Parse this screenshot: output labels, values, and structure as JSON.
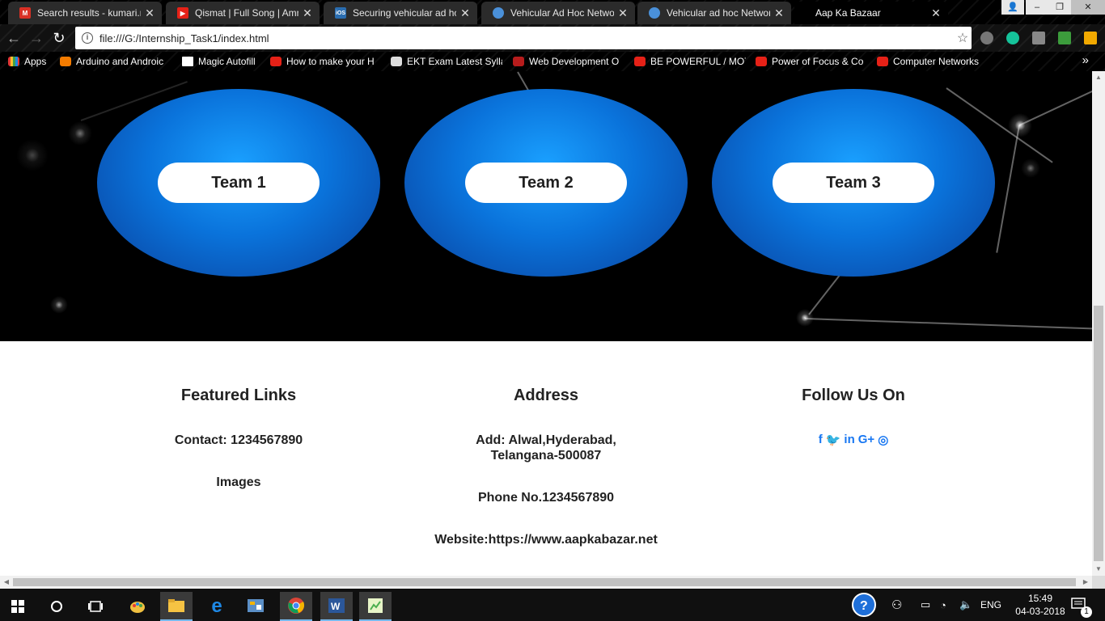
{
  "browser": {
    "tabs": [
      {
        "title": "Search results - kumari.re",
        "icon": "gmail-icon",
        "color": "#d93025"
      },
      {
        "title": "Qismat | Full Song | Amm",
        "icon": "youtube-icon",
        "color": "#e62117"
      },
      {
        "title": "Securing vehicular ad ho",
        "icon": "ios-icon",
        "color": "#2a6db0",
        "icon_text": "iOS"
      },
      {
        "title": "Vehicular Ad Hoc Networ",
        "icon": "document-icon",
        "color": "#4a90d9"
      },
      {
        "title": "Vehicular ad hoc Networ",
        "icon": "document-icon",
        "color": "#4a90d9"
      },
      {
        "title": "Aap Ka Bazaar",
        "icon": "",
        "color": "#000000"
      }
    ],
    "url": "file:///G:/Internship_Task1/index.html",
    "bookmarks": [
      {
        "label": "Apps",
        "icon": "apps-grid-icon"
      },
      {
        "label": "Arduino and Androic",
        "icon": "blogger-icon"
      },
      {
        "label": "Magic Autofill",
        "icon": "page-icon"
      },
      {
        "label": "How to make your H",
        "icon": "youtube-icon"
      },
      {
        "label": "EKT Exam Latest Sylla",
        "icon": "ekt-icon"
      },
      {
        "label": "Web Development O",
        "icon": "infinity-icon"
      },
      {
        "label": "BE POWERFUL / MOT",
        "icon": "youtube-icon"
      },
      {
        "label": "Power of Focus & Co",
        "icon": "youtube-icon"
      },
      {
        "label": "Computer Networks",
        "icon": "youtube-icon"
      }
    ],
    "bookmarks_more": "»"
  },
  "hero": {
    "teams": [
      {
        "label": "Team 1"
      },
      {
        "label": "Team 2"
      },
      {
        "label": "Team 3"
      }
    ]
  },
  "footer": {
    "featured": {
      "heading": "Featured Links",
      "contact": "Contact: 1234567890",
      "images": "Images"
    },
    "address": {
      "heading": "Address",
      "add_line1": "Add: Alwal,Hyderabad,",
      "add_line2": "Telangana-500087",
      "phone": "Phone No.1234567890",
      "website": "Website:https://www.aapkabazar.net"
    },
    "follow": {
      "heading": "Follow Us On",
      "icons": [
        "facebook-icon",
        "twitter-icon",
        "linkedin-icon",
        "google-plus-icon",
        "instagram-icon"
      ]
    }
  },
  "taskbar": {
    "time": "15:49",
    "date": "04-03-2018",
    "lang": "ENG",
    "notifications": "1"
  },
  "colors": {
    "accent_blue": "#0a73db",
    "social_blue": "#1877f2"
  }
}
